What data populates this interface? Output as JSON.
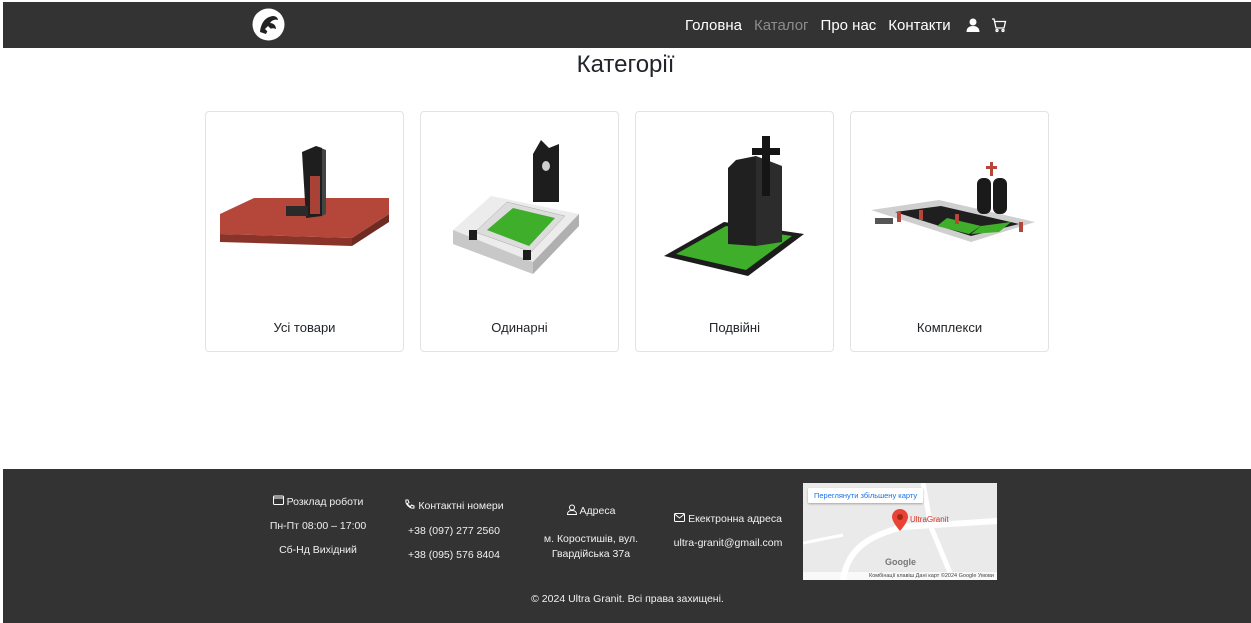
{
  "nav": {
    "links": [
      "Головна",
      "Каталог",
      "Про нас",
      "Контакти"
    ],
    "active_link": "Каталог",
    "user_icon": "user-icon",
    "cart_icon": "cart-icon",
    "logo_icon": "logo-icon"
  },
  "page_title": "Категорії",
  "categories": [
    {
      "label": "Усі товари"
    },
    {
      "label": "Одинарні"
    },
    {
      "label": "Подвійні"
    },
    {
      "label": "Комплекси"
    }
  ],
  "footer": {
    "schedule": {
      "title": "Розклад роботи",
      "lines": [
        "Пн-Пт 08:00 – 17:00",
        "Сб-Нд Вихідний"
      ]
    },
    "phones": {
      "title": "Контактні номери",
      "lines": [
        "+38 (097) 277 2560",
        "+38 (095) 576 8404"
      ]
    },
    "address": {
      "title": "Адреса",
      "lines": [
        "м. Коростишів, вул.",
        "Гвардійська 37а"
      ]
    },
    "email": {
      "title": "Екектронна адреса",
      "lines": [
        "ultra-granit@gmail.com"
      ]
    },
    "map": {
      "button": "Переглянути збільшену карту",
      "pin_label": "UltraGranit",
      "google": "Google",
      "attribution": "Комбінації клавіш   Дані карт ©2024 Google   Умови"
    },
    "copyright": "© 2024 Ultra Granit. Всі права захищені."
  },
  "colors": {
    "header_bg": "#333333",
    "footer_bg": "#333333",
    "active_nav": "#8c8c8c",
    "grass": "#3fae2a",
    "granite_red": "#b5473a"
  }
}
